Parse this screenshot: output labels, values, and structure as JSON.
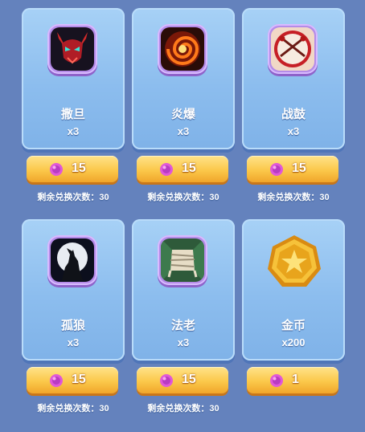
{
  "items": [
    {
      "name": "撒旦",
      "qty": "x3",
      "price": "15",
      "remaining_label": "剩余兑换次数：",
      "remaining": "30",
      "icon": "demon-mask-icon"
    },
    {
      "name": "炎爆",
      "qty": "x3",
      "price": "15",
      "remaining_label": "剩余兑换次数：",
      "remaining": "30",
      "icon": "fire-vortex-icon"
    },
    {
      "name": "战鼓",
      "qty": "x3",
      "price": "15",
      "remaining_label": "剩余兑换次数：",
      "remaining": "30",
      "icon": "war-drum-icon"
    },
    {
      "name": "孤狼",
      "qty": "x3",
      "price": "15",
      "remaining_label": "剩余兑换次数：",
      "remaining": "30",
      "icon": "howling-wolf-icon"
    },
    {
      "name": "法老",
      "qty": "x3",
      "price": "15",
      "remaining_label": "剩余兑换次数：",
      "remaining": "30",
      "icon": "mummy-icon"
    },
    {
      "name": "金币",
      "qty": "x200",
      "price": "1",
      "remaining_label": "",
      "remaining": "",
      "icon": "gold-coin-icon"
    }
  ],
  "currency_icon": "purple-gem-icon",
  "colors": {
    "background": "#6482bd",
    "card": "#8cbdee",
    "frame": "#b58be8",
    "button": "#fbc84a"
  }
}
